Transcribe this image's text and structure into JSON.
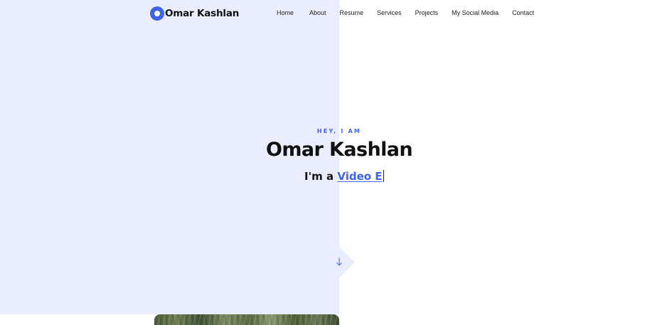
{
  "header": {
    "logo_text": "Omar Kashlan",
    "nav": [
      {
        "label": "Home"
      },
      {
        "label": "About"
      },
      {
        "label": "Resume"
      },
      {
        "label": "Services"
      },
      {
        "label": "Projects"
      },
      {
        "label": "My Social Media"
      },
      {
        "label": "Contact"
      }
    ]
  },
  "hero": {
    "kicker": "HEY, I AM",
    "name": "Omar Kashlan",
    "role_prefix": "I'm a",
    "role_typed": "Video E"
  },
  "icons": {
    "logo_mark": "logo-circle-icon",
    "scroll_down": "arrow-down-icon"
  },
  "colors": {
    "accent": "#3e63f0",
    "panel": "#e9edfd",
    "text": "#111111"
  }
}
